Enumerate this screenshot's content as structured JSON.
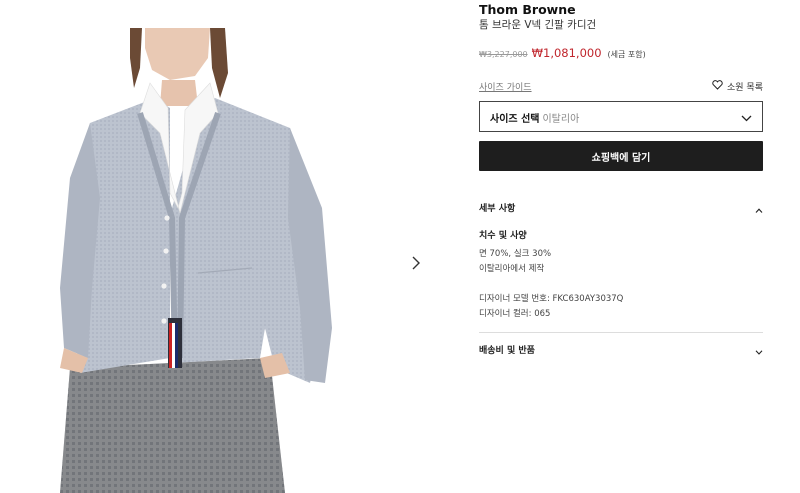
{
  "product": {
    "brand": "Thom Browne",
    "name": "톰 브라운 V넥 긴팔 카디건",
    "old_price": "₩3,227,000",
    "price": "₩1,081,000",
    "tax_note": "(세금 포함)"
  },
  "actions": {
    "size_guide": "사이즈 가이드",
    "wishlist": "소원 목록",
    "size_label": "사이즈 선택",
    "size_value": "이탈리아",
    "add_to_bag": "쇼핑백에 담기"
  },
  "details": {
    "title": "세부 사항",
    "section_title": "치수 및 사양",
    "composition": "면 70%, 실크 30%",
    "origin": "이탈리아에서 제작",
    "model_number": "디자이너 모델 번호: FKC630AY3037Q",
    "color": "디자이너 컬러: 065"
  },
  "shipping": {
    "title": "배송비 및 반품"
  },
  "icons": {
    "next": "chevron-right-icon",
    "wishlist": "heart-outline-icon",
    "dropdown": "chevron-down-icon",
    "collapse": "chevron-up-icon",
    "expand": "chevron-down-icon"
  },
  "colors": {
    "sale_red": "#c0262d",
    "button_bg": "#1e1e1e",
    "cardigan": "#b9c0cc"
  }
}
